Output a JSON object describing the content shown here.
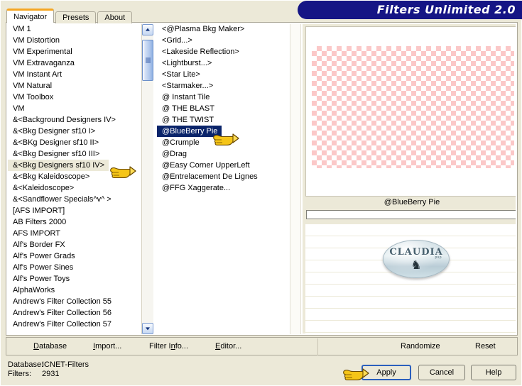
{
  "window": {
    "title": "Filters Unlimited 2.0",
    "title_color": "#151585"
  },
  "tabs": [
    {
      "label": "Navigator",
      "active": true
    },
    {
      "label": "Presets",
      "active": false
    },
    {
      "label": "About",
      "active": false
    }
  ],
  "left_list": {
    "items": [
      {
        "label": "VM 1"
      },
      {
        "label": "VM Distortion"
      },
      {
        "label": "VM Experimental"
      },
      {
        "label": "VM Extravaganza"
      },
      {
        "label": "VM Instant Art"
      },
      {
        "label": "VM Natural"
      },
      {
        "label": "VM Toolbox"
      },
      {
        "label": "VM"
      },
      {
        "label": "&<Background Designers IV>"
      },
      {
        "label": "&<Bkg Designer sf10 I>"
      },
      {
        "label": "&<BKg Designer sf10 II>"
      },
      {
        "label": "&<Bkg Designer sf10 III>"
      },
      {
        "label": "&<Bkg Designers sf10 IV>",
        "selected": true
      },
      {
        "label": "&<Bkg Kaleidoscope>"
      },
      {
        "label": "&<Kaleidoscope>"
      },
      {
        "label": "&<Sandflower Specials^v^ >"
      },
      {
        "label": "[AFS IMPORT]"
      },
      {
        "label": "AB Filters 2000"
      },
      {
        "label": "AFS IMPORT"
      },
      {
        "label": "Alf's Border FX"
      },
      {
        "label": "Alf's Power Grads"
      },
      {
        "label": "Alf's Power Sines"
      },
      {
        "label": "Alf's Power Toys"
      },
      {
        "label": "AlphaWorks"
      },
      {
        "label": "Andrew's Filter Collection 55"
      },
      {
        "label": "Andrew's Filter Collection 56"
      },
      {
        "label": "Andrew's Filter Collection 57"
      }
    ]
  },
  "mid_list": {
    "items": [
      {
        "label": "<@Plasma Bkg Maker>"
      },
      {
        "label": "<Grid...>"
      },
      {
        "label": "<Lakeside Reflection>"
      },
      {
        "label": "<Lightburst...>"
      },
      {
        "label": "<Star Lite>"
      },
      {
        "label": "<Starmaker...>"
      },
      {
        "label": "@ Instant Tile"
      },
      {
        "label": "@ THE BLAST"
      },
      {
        "label": "@ THE TWIST"
      },
      {
        "label": "@BlueBerry Pie",
        "selected": true
      },
      {
        "label": "@Crumple"
      },
      {
        "label": "@Drag"
      },
      {
        "label": "@Easy Corner UpperLeft"
      },
      {
        "label": "@Entrelacement De Lignes"
      },
      {
        "label": "@FFG Xaggerate..."
      }
    ]
  },
  "preview": {
    "caption": "@BlueBerry Pie",
    "checker_color": "#fbc6c6",
    "progress_value": "",
    "logo_text": "CLAUDIA",
    "logo_sub": "psp",
    "logo_figure": "♞"
  },
  "menubar": {
    "items": [
      {
        "label": "Database",
        "accel": "D"
      },
      {
        "label": "Import...",
        "accel": "I"
      },
      {
        "label": "Filter Info...",
        "accel": "n"
      },
      {
        "label": "Editor...",
        "accel": "E"
      },
      {
        "label": "Randomize",
        "accel": ""
      },
      {
        "label": "Reset",
        "accel": ""
      }
    ]
  },
  "status": {
    "database_label": "Database:",
    "database_value": "ICNET-Filters",
    "filters_label": "Filters:",
    "filters_value": "2931"
  },
  "buttons": {
    "apply": "Apply",
    "cancel": "Cancel",
    "help": "Help"
  }
}
